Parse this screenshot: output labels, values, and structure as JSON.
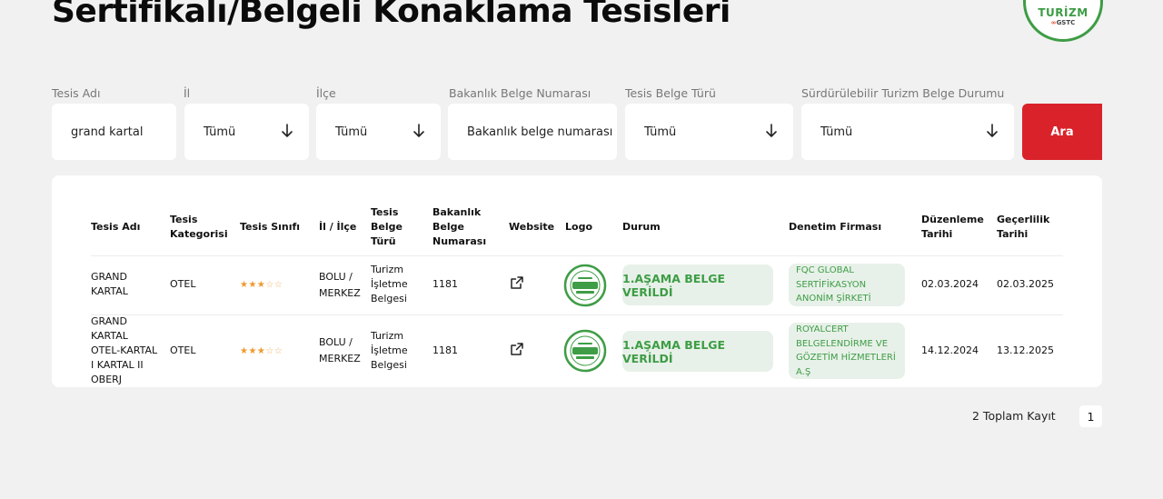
{
  "page": {
    "title": "Sertifikalı/Belgeli Konaklama Tesisleri"
  },
  "brand": {
    "word": "TURİZM",
    "gstc": "GSTC"
  },
  "filters": {
    "facility_name": {
      "label": "Tesis Adı",
      "value": "grand kartal"
    },
    "province": {
      "label": "İl",
      "value": "Tümü"
    },
    "district": {
      "label": "İlçe",
      "value": "Tümü"
    },
    "ministry_cert_no": {
      "label": "Bakanlık Belge Numarası",
      "placeholder": "Bakanlık belge numarası"
    },
    "cert_type": {
      "label": "Tesis Belge Türü",
      "value": "Tümü"
    },
    "sustainable_status": {
      "label": "Sürdürülebilir Turizm Belge Durumu",
      "value": "Tümü"
    },
    "search_label": "Ara"
  },
  "table": {
    "headers": {
      "name": "Tesis Adı",
      "category": "Tesis Kategorisi",
      "class": "Tesis Sınıfı",
      "location": "İl / İlçe",
      "cert_type": "Tesis Belge Türü",
      "cert_no": "Bakanlık Belge Numarası",
      "website": "Website",
      "logo": "Logo",
      "status": "Durum",
      "audit": "Denetim Firması",
      "issue_date": "Düzenleme Tarihi",
      "valid_date": "Geçerlilik Tarihi"
    },
    "rows": [
      {
        "name": "GRAND KARTAL",
        "category": "OTEL",
        "stars": 3,
        "location": "BOLU / MERKEZ",
        "cert_type": "Turizm İşletme Belgesi",
        "cert_no": "1181",
        "website_icon": "external-link-icon",
        "status": "1.AŞAMA BELGE VERİLDİ",
        "audit": "FQC GLOBAL SERTİFİKASYON ANONİM ŞİRKETİ",
        "issue_date": "02.03.2024",
        "valid_date": "02.03.2025"
      },
      {
        "name": "GRAND KARTAL OTEL-KARTAL I KARTAL II OBERJ",
        "category": "OTEL",
        "stars": 3,
        "location": "BOLU / MERKEZ",
        "cert_type": "Turizm İşletme Belgesi",
        "cert_no": "1181",
        "website_icon": "external-link-icon",
        "status": "1.AŞAMA BELGE VERİLDİ",
        "audit": "ROYALCERT BELGELENDİRME VE GÖZETİM HİZMETLERİ A.Ş",
        "issue_date": "14.12.2024",
        "valid_date": "13.12.2025"
      }
    ]
  },
  "pagination": {
    "total": "2 Toplam Kayıt",
    "current_page": "1"
  },
  "colors": {
    "accent_red": "#d9222a",
    "status_green": "#3e9d46",
    "pill_bg": "#e8f1e9",
    "star": "#f0992b"
  }
}
